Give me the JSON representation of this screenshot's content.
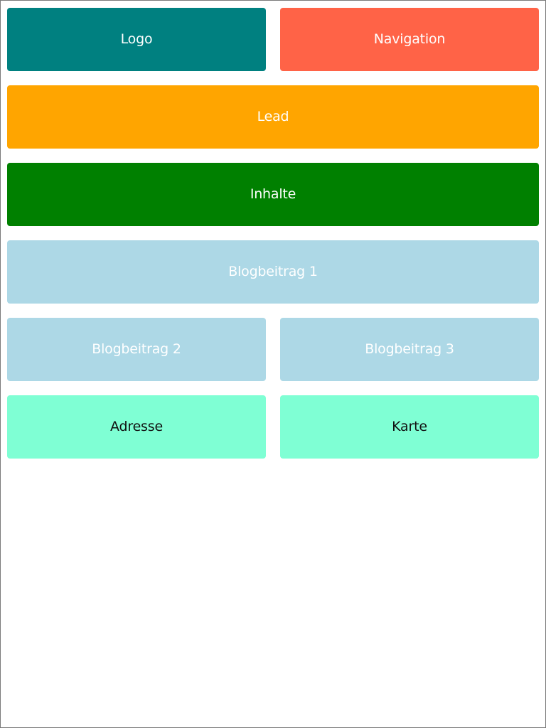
{
  "layout": {
    "logo": {
      "label": "Logo",
      "color": "#008080"
    },
    "navigation": {
      "label": "Navigation",
      "color": "#ff6347"
    },
    "lead": {
      "label": "Lead",
      "color": "#ffa500"
    },
    "content": {
      "label": "Inhalte",
      "color": "#008000"
    },
    "blog_posts": [
      {
        "label": "Blogbeitrag 1",
        "color": "#add8e6"
      },
      {
        "label": "Blogbeitrag 2",
        "color": "#add8e6"
      },
      {
        "label": "Blogbeitrag 3",
        "color": "#add8e6"
      }
    ],
    "address": {
      "label": "Adresse",
      "color": "#7fffd4"
    },
    "map": {
      "label": "Karte",
      "color": "#7fffd4"
    }
  }
}
